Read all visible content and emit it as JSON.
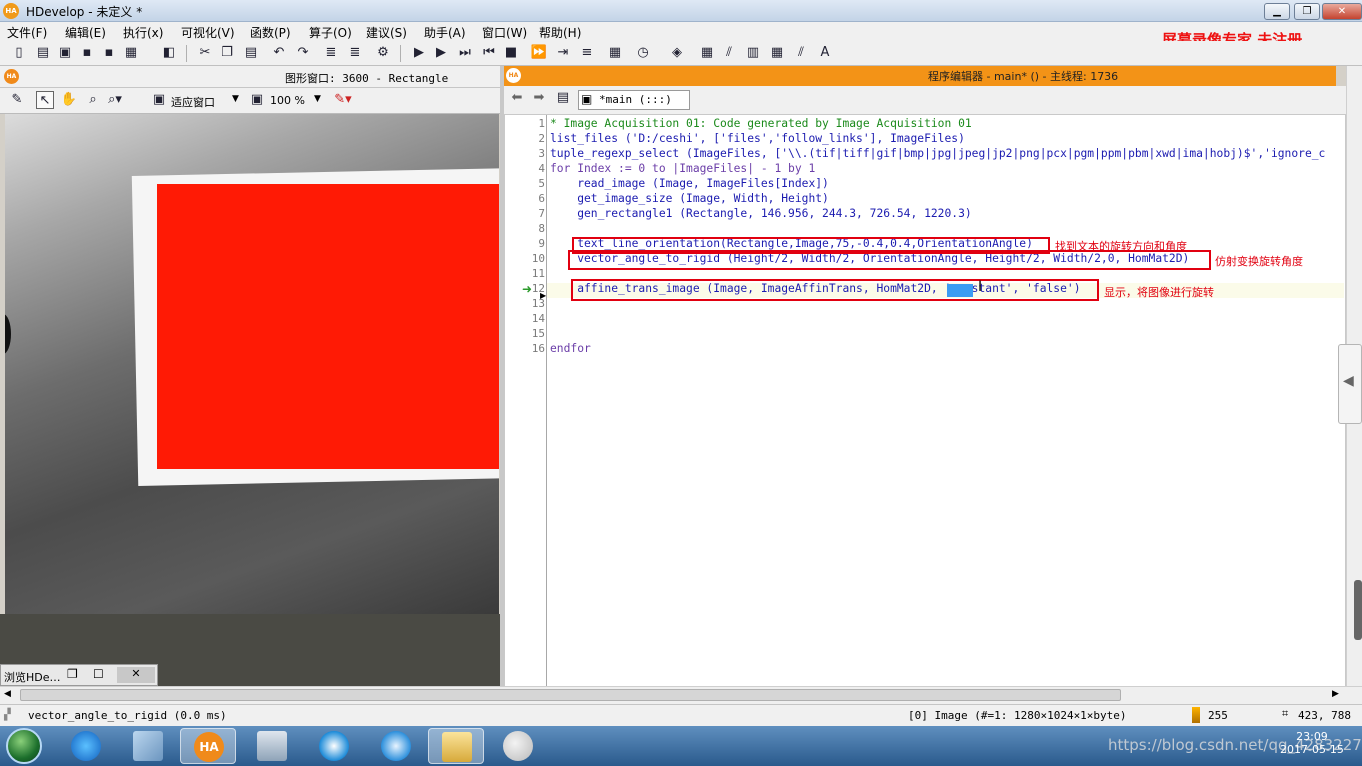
{
  "window": {
    "title": "HDevelop - 未定义 *",
    "app_badge": "HA",
    "controls": [
      "▁",
      "❐",
      "✕"
    ]
  },
  "menu": [
    "文件(F)",
    "编辑(E)",
    "执行(x)",
    "可视化(V)",
    "函数(P)",
    "算子(O)",
    "建议(S)",
    "助手(A)",
    "窗口(W)",
    "帮助(H)"
  ],
  "watermark": "屏幕录像专家 未注册",
  "graphics_window": {
    "title": "图形窗口: 3600 - Rectangle",
    "fit_label": "适应窗口",
    "zoom": "100 %"
  },
  "browse_tab": {
    "label": "浏览HDe…"
  },
  "program_editor": {
    "title": "程序编辑器 - main* () - 主线程: 1736",
    "tab_label": "*main (:::)",
    "lines": [
      {
        "n": "1",
        "text": "* Image Acquisition 01: Code generated by Image Acquisition 01"
      },
      {
        "n": "2",
        "text": "list_files ('D:/ceshi', ['files','follow_links'], ImageFiles)"
      },
      {
        "n": "3",
        "text": "tuple_regexp_select (ImageFiles, ['\\\\.(tif|tiff|gif|bmp|jpg|jpeg|jp2|png|pcx|pgm|ppm|pbm|xwd|ima|hobj)$','ignore_c"
      },
      {
        "n": "4",
        "text": "for Index := 0 to |ImageFiles| - 1 by 1"
      },
      {
        "n": "5",
        "text": "    read_image (Image, ImageFiles[Index])"
      },
      {
        "n": "6",
        "text": "    get_image_size (Image, Width, Height)"
      },
      {
        "n": "7",
        "text": "    gen_rectangle1 (Rectangle, 146.956, 244.3, 726.54, 1220.3)"
      },
      {
        "n": "8",
        "text": ""
      },
      {
        "n": "9",
        "text": "    text_line_orientation(Rectangle,Image,75,-0.4,0.4,OrientationAngle)"
      },
      {
        "n": "10",
        "text": "    vector_angle_to_rigid (Height/2, Width/2, OrientationAngle, Height/2, Width/2,0, HomMat2D)"
      },
      {
        "n": "11",
        "text": ""
      },
      {
        "n": "12",
        "text": "    affine_trans_image (Image, ImageAffinTrans, HomMat2D, 'constant', 'false')"
      },
      {
        "n": "13",
        "text": ""
      },
      {
        "n": "14",
        "text": ""
      },
      {
        "n": "15",
        "text": ""
      },
      {
        "n": "16",
        "text": "endfor"
      }
    ],
    "annotations": [
      "找到文本的旋转方向和角度",
      "仿射变换旋转角度",
      "显示，将图像进行旋转"
    ]
  },
  "status": {
    "operator": "vector_angle_to_rigid (0.0 ms)",
    "image_info": "[0] Image (#=1: 1280×1024×1×byte)",
    "gray_value": "255",
    "coords": "423, 788"
  },
  "taskbar": {
    "clock_time": "23:09",
    "clock_date": "2017-05-15",
    "url_watermark": "https://blog.csdn.net/qq_42832272"
  },
  "colors": {
    "accent_orange": "#f39317",
    "annotation_red": "#e10010",
    "image_red": "#ff1a05"
  }
}
